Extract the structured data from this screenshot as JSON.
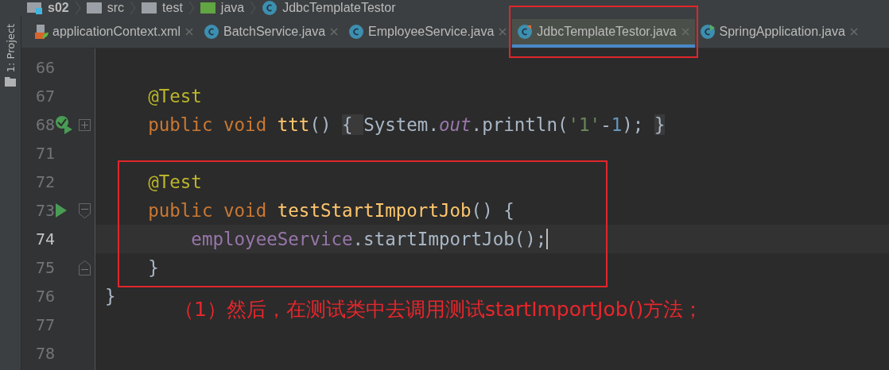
{
  "breadcrumbs": [
    {
      "label": "s02",
      "kind": "module"
    },
    {
      "label": "src",
      "kind": "folder"
    },
    {
      "label": "test",
      "kind": "folder"
    },
    {
      "label": "java",
      "kind": "source"
    },
    {
      "label": "JdbcTemplateTestor",
      "kind": "class"
    }
  ],
  "sidebar": {
    "label": "1: Project"
  },
  "tabs": [
    {
      "label": "applicationContext.xml",
      "kind": "xml",
      "selected": false
    },
    {
      "label": "BatchService.java",
      "kind": "class",
      "selected": false
    },
    {
      "label": "EmployeeService.java",
      "kind": "class",
      "selected": false
    },
    {
      "label": "JdbcTemplateTestor.java",
      "kind": "test",
      "selected": true
    },
    {
      "label": "SpringApplication.java",
      "kind": "spring",
      "selected": false
    }
  ],
  "editor": {
    "lines": [
      {
        "number": "66",
        "current": false
      },
      {
        "number": "67",
        "current": false,
        "tokens": [
          {
            "kind": "annotation",
            "text": "    @Test"
          }
        ]
      },
      {
        "number": "68",
        "current": false,
        "run_marker": {
          "kind": "passed"
        },
        "fold_marker": {
          "kind": "collapsed"
        },
        "tokens": [
          {
            "kind": "keyword",
            "text": "    public void "
          },
          {
            "kind": "method",
            "text": "ttt"
          },
          {
            "kind": "plain",
            "text": "() "
          },
          {
            "kind": "folded",
            "text": "{ "
          },
          {
            "kind": "plain",
            "text": "System."
          },
          {
            "kind": "static",
            "text": "out"
          },
          {
            "kind": "plain",
            "text": ".println("
          },
          {
            "kind": "string",
            "text": "'1'"
          },
          {
            "kind": "plain",
            "text": "-"
          },
          {
            "kind": "number",
            "text": "1"
          },
          {
            "kind": "plain",
            "text": "); "
          },
          {
            "kind": "folded",
            "text": "}"
          }
        ]
      },
      {
        "number": "71",
        "current": false
      },
      {
        "number": "72",
        "current": false,
        "tokens": [
          {
            "kind": "annotation",
            "text": "    @Test"
          }
        ]
      },
      {
        "number": "73",
        "current": false,
        "run_marker": {
          "kind": "run"
        },
        "fold_marker": {
          "kind": "start"
        },
        "tokens": [
          {
            "kind": "keyword",
            "text": "    public void "
          },
          {
            "kind": "method",
            "text": "testStartImportJob"
          },
          {
            "kind": "plain",
            "text": "() {"
          }
        ]
      },
      {
        "number": "74",
        "current": true,
        "tokens": [
          {
            "kind": "field",
            "text": "        employeeService"
          },
          {
            "kind": "plain",
            "text": ".startImportJob();"
          }
        ]
      },
      {
        "number": "75",
        "current": false,
        "fold_marker": {
          "kind": "end"
        },
        "tokens": [
          {
            "kind": "plain",
            "text": "    }"
          }
        ]
      },
      {
        "number": "76",
        "current": false,
        "tokens": [
          {
            "kind": "plain",
            "text": "}"
          }
        ]
      },
      {
        "number": "77",
        "current": false
      },
      {
        "number": "78",
        "current": false
      }
    ]
  },
  "annotation": {
    "text": "（1）然后，在测试类中去调用测试startImportJob()方法；"
  }
}
